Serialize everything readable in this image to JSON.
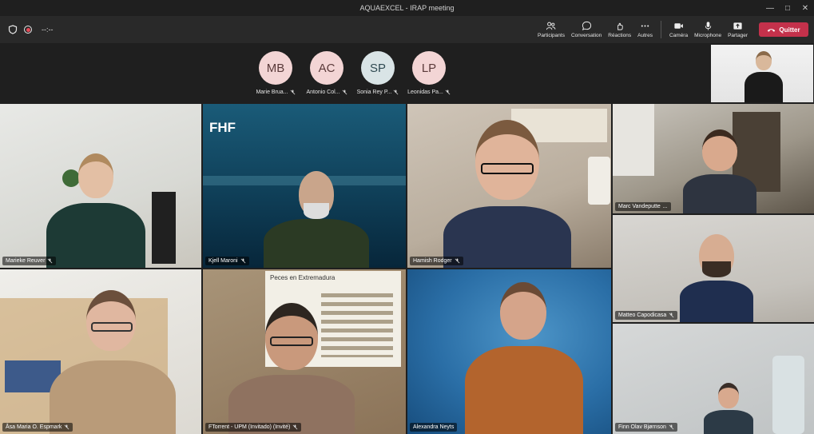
{
  "window": {
    "title": "AQUAEXCEL - IRAP meeting",
    "controls": [
      "minimize",
      "maximize",
      "close"
    ]
  },
  "toolbar": {
    "timer": "--:--",
    "buttons": [
      {
        "label": "Participants",
        "icon": "participants-icon"
      },
      {
        "label": "Conversation",
        "icon": "chat-icon"
      },
      {
        "label": "Réactions",
        "icon": "reactions-icon"
      },
      {
        "label": "Autres",
        "icon": "more-icon"
      },
      {
        "label": "Caméra",
        "icon": "camera-icon"
      },
      {
        "label": "Microphone",
        "icon": "microphone-icon"
      },
      {
        "label": "Partager",
        "icon": "share-icon"
      }
    ],
    "quit_label": "Quitter",
    "quit_color": "#c4314b"
  },
  "avatars": [
    {
      "initials": "MB",
      "name": "Marie Brua...",
      "color": "#f3d5d5"
    },
    {
      "initials": "AC",
      "name": "Antonio Col...",
      "color": "#f3d5d5"
    },
    {
      "initials": "SP",
      "name": "Sonia Rey P...",
      "color": "#d9e4e6"
    },
    {
      "initials": "LP",
      "name": "Leonidas Pa...",
      "color": "#f3d5d5"
    }
  ],
  "tiles": [
    {
      "name": "Marieke Reuver"
    },
    {
      "name": "Kjell Maroni",
      "logo": "FHF"
    },
    {
      "name": "Hamish Rodger"
    },
    {
      "name": "Marc Vandeputte",
      "more": "..."
    },
    {
      "name": "Matteo Capodicasa"
    },
    {
      "name": "Åsa Maria O. Espmark"
    },
    {
      "name": "FTorrent - UPM (Invitado) (Invité)",
      "poster": "Peces en Extremadura"
    },
    {
      "name": "Alexandra Neyts"
    },
    {
      "name": "Finn Olav Bjørnson"
    }
  ]
}
